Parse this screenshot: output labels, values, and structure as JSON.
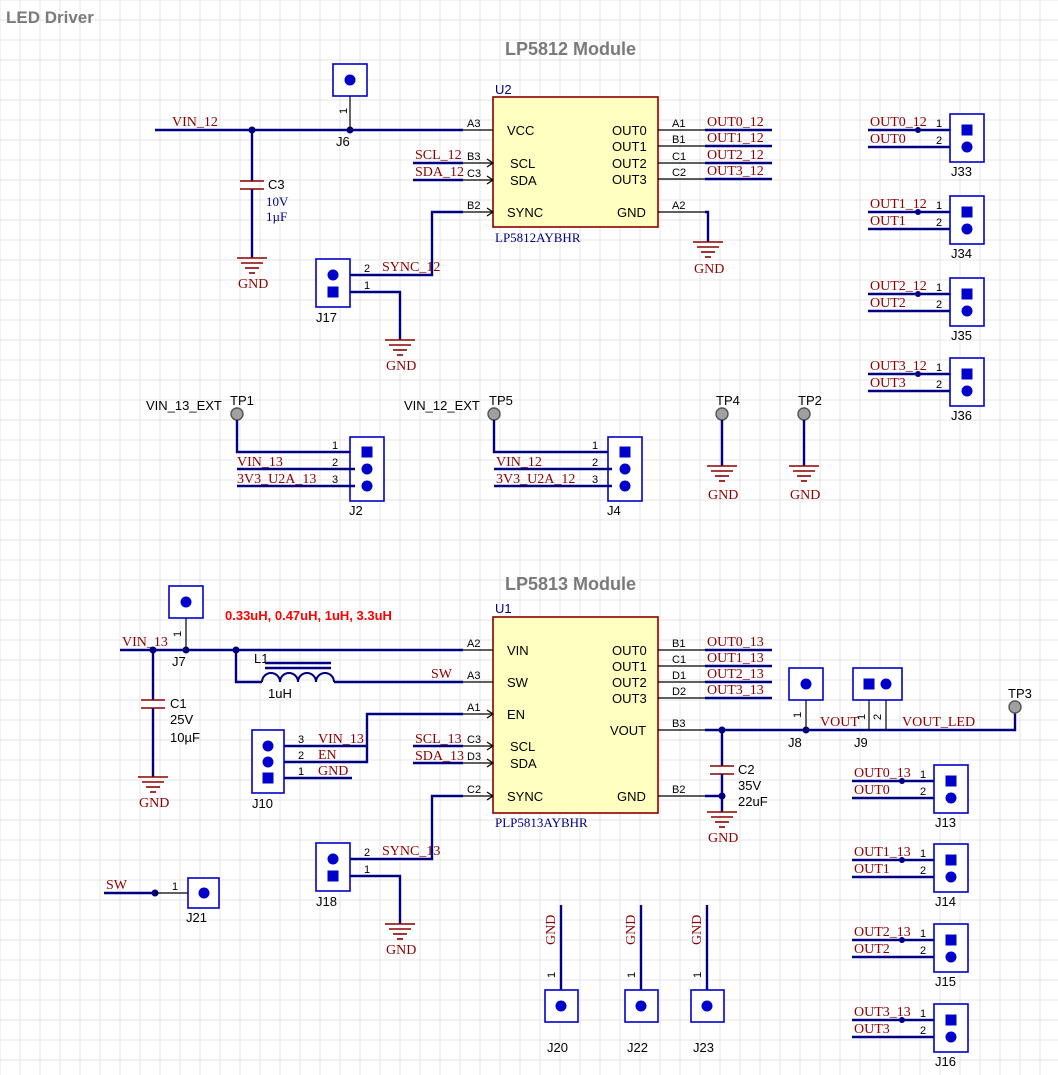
{
  "page_title": "LED Driver",
  "module_lp5812": {
    "title": "LP5812 Module",
    "ic": {
      "designator": "U2",
      "part_number": "LP5812AYBHR",
      "left_pins": [
        {
          "num": "A3",
          "name": "VCC"
        },
        {
          "num": "B3",
          "name": "SCL"
        },
        {
          "num": "C3",
          "name": "SDA"
        },
        {
          "num": "B2",
          "name": "SYNC"
        }
      ],
      "right_pins": [
        {
          "num": "A1",
          "name": "OUT0"
        },
        {
          "num": "B1",
          "name": "OUT1"
        },
        {
          "num": "C1",
          "name": "OUT2"
        },
        {
          "num": "C2",
          "name": "OUT3"
        },
        {
          "num": "A2",
          "name": "GND"
        }
      ]
    },
    "nets": {
      "vin": "VIN_12",
      "scl": "SCL_12",
      "sda": "SDA_12",
      "sync": "SYNC_12",
      "out0": "OUT0_12",
      "out1": "OUT1_12",
      "out2": "OUT2_12",
      "out3": "OUT3_12"
    },
    "cap": {
      "designator": "C3",
      "voltage": "10V",
      "value": "1µF"
    },
    "j6": "J6",
    "j17": {
      "designator": "J17",
      "pin2": "2",
      "pin1": "1"
    },
    "gnd": "GND"
  },
  "test_points": {
    "tp1": {
      "designator": "TP1",
      "net": "VIN_13_EXT"
    },
    "tp5": {
      "designator": "TP5",
      "net": "VIN_12_EXT"
    },
    "tp4": {
      "designator": "TP4"
    },
    "tp2": {
      "designator": "TP2"
    },
    "tp3": {
      "designator": "TP3"
    }
  },
  "j2": {
    "designator": "J2",
    "pins": [
      {
        "num": "1",
        "net": ""
      },
      {
        "num": "2",
        "net": "VIN_13"
      },
      {
        "num": "3",
        "net": "3V3_U2A_13"
      }
    ]
  },
  "j4": {
    "designator": "J4",
    "pins": [
      {
        "num": "1",
        "net": ""
      },
      {
        "num": "2",
        "net": "VIN_12"
      },
      {
        "num": "3",
        "net": "3V3_U2A_12"
      }
    ]
  },
  "out_headers_12": [
    {
      "designator": "J33",
      "net1": "OUT0_12",
      "net2": "OUT0"
    },
    {
      "designator": "J34",
      "net1": "OUT1_12",
      "net2": "OUT1"
    },
    {
      "designator": "J35",
      "net1": "OUT2_12",
      "net2": "OUT2"
    },
    {
      "designator": "J36",
      "net1": "OUT3_12",
      "net2": "OUT3"
    }
  ],
  "module_lp5813": {
    "title": "LP5813 Module",
    "inductor_note": "0.33uH, 0.47uH, 1uH, 3.3uH",
    "ic": {
      "designator": "U1",
      "part_number": "PLP5813AYBHR",
      "left_pins": [
        {
          "num": "A2",
          "name": "VIN"
        },
        {
          "num": "A3",
          "name": "SW"
        },
        {
          "num": "A1",
          "name": "EN"
        },
        {
          "num": "C3",
          "name": "SCL"
        },
        {
          "num": "D3",
          "name": "SDA"
        },
        {
          "num": "C2",
          "name": "SYNC"
        }
      ],
      "right_pins": [
        {
          "num": "B1",
          "name": "OUT0"
        },
        {
          "num": "C1",
          "name": "OUT1"
        },
        {
          "num": "D1",
          "name": "OUT2"
        },
        {
          "num": "D2",
          "name": "OUT3"
        },
        {
          "num": "B3",
          "name": "VOUT"
        },
        {
          "num": "B2",
          "name": "GND"
        }
      ]
    },
    "nets": {
      "vin": "VIN_13",
      "sw": "SW",
      "scl": "SCL_13",
      "sda": "SDA_13",
      "sync": "SYNC_13",
      "out0": "OUT0_13",
      "out1": "OUT1_13",
      "out2": "OUT2_13",
      "out3": "OUT3_13",
      "vout": "VOUT",
      "vout_led": "VOUT_LED"
    },
    "l1": {
      "designator": "L1",
      "value": "1uH"
    },
    "c1": {
      "designator": "C1",
      "voltage": "25V",
      "value": "10µF"
    },
    "c2": {
      "designator": "C2",
      "voltage": "35V",
      "value": "22uF"
    },
    "j7": "J7",
    "j8": "J8",
    "j9": "J9",
    "j10": {
      "designator": "J10",
      "pins": [
        {
          "num": "3",
          "net": "VIN_13"
        },
        {
          "num": "2",
          "net": "EN"
        },
        {
          "num": "1",
          "net": "GND"
        }
      ]
    },
    "j18": {
      "designator": "J18",
      "pin2": "2",
      "pin1": "1"
    },
    "j21": {
      "designator": "J21",
      "net": "SW",
      "pin": "1"
    },
    "gnd_headers": [
      "J20",
      "J22",
      "J23"
    ],
    "gnd": "GND"
  },
  "out_headers_13": [
    {
      "designator": "J13",
      "net1": "OUT0_13",
      "net2": "OUT0"
    },
    {
      "designator": "J14",
      "net1": "OUT1_13",
      "net2": "OUT1"
    },
    {
      "designator": "J15",
      "net1": "OUT2_13",
      "net2": "OUT2"
    },
    {
      "designator": "J16",
      "net1": "OUT3_13",
      "net2": "OUT3"
    }
  ]
}
